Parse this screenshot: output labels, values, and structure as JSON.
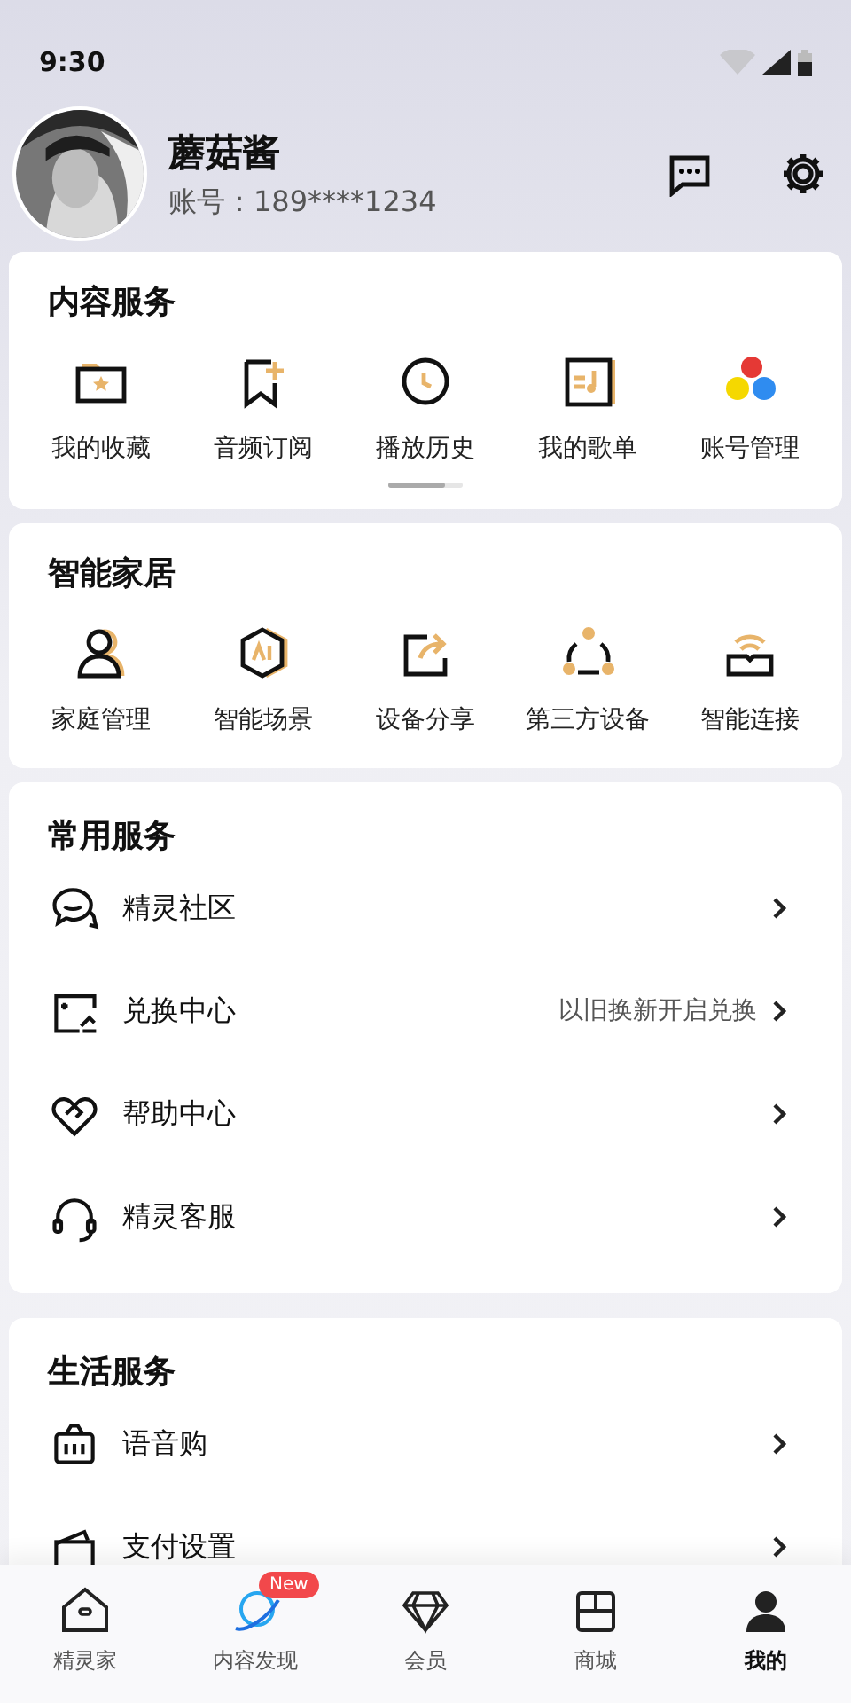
{
  "status_bar": {
    "time": "9:30"
  },
  "profile": {
    "name": "蘑菇酱",
    "account": "账号：189****1234"
  },
  "content_services": {
    "title": "内容服务",
    "items": [
      {
        "label": "我的收藏"
      },
      {
        "label": "音频订阅"
      },
      {
        "label": "播放历史"
      },
      {
        "label": "我的歌单"
      },
      {
        "label": "账号管理"
      }
    ]
  },
  "smart_home": {
    "title": "智能家居",
    "items": [
      {
        "label": "家庭管理"
      },
      {
        "label": "智能场景"
      },
      {
        "label": "设备分享"
      },
      {
        "label": "第三方设备"
      },
      {
        "label": "智能连接"
      }
    ]
  },
  "common_services": {
    "title": "常用服务",
    "items": [
      {
        "label": "精灵社区"
      },
      {
        "label": "兑换中心",
        "hint": "以旧换新开启兑换"
      },
      {
        "label": "帮助中心"
      },
      {
        "label": "精灵客服"
      }
    ]
  },
  "life_services": {
    "title": "生活服务",
    "items": [
      {
        "label": "语音购"
      },
      {
        "label": "支付设置"
      }
    ]
  },
  "tab_bar": [
    {
      "label": "精灵家",
      "selected": false
    },
    {
      "label": "内容发现",
      "selected": false,
      "badge": "New"
    },
    {
      "label": "会员",
      "selected": false
    },
    {
      "label": "商城",
      "selected": false
    },
    {
      "label": "我的",
      "selected": true
    }
  ]
}
